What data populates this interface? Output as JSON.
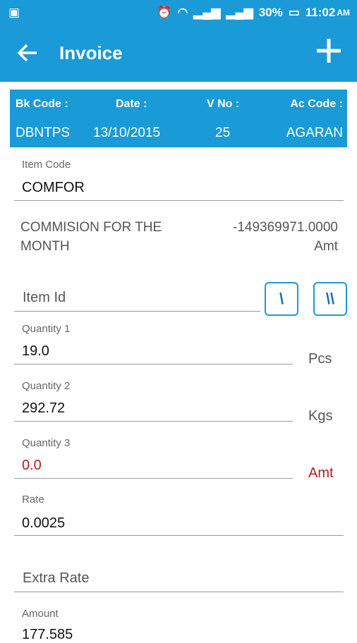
{
  "status": {
    "battery": "30%",
    "time": "11:02",
    "ampm": "AM"
  },
  "appbar": {
    "title": "Invoice",
    "back_icon": "arrow-back-icon",
    "add_icon": "plus-icon"
  },
  "header": {
    "bk_code_label": "Bk Code :",
    "date_label": "Date :",
    "vno_label": "V No :",
    "ac_code_label": "Ac Code :",
    "bk_code": "DBNTPS",
    "date": "13/10/2015",
    "vno": "25",
    "ac_code": "AGARAN"
  },
  "item_code": {
    "label": "Item Code",
    "value": "COMFOR"
  },
  "description": {
    "line1": "COMMISION FOR THE",
    "line2": "MONTH",
    "amount": "-149369971.0000",
    "amount_unit": "Amt"
  },
  "item_id": {
    "placeholder": "Item Id",
    "btn1": "\\",
    "btn2": "\\\\"
  },
  "quantity1": {
    "label": "Quantity 1",
    "value": "19.0",
    "unit": "Pcs"
  },
  "quantity2": {
    "label": "Quantity 2",
    "value": "292.72",
    "unit": "Kgs"
  },
  "quantity3": {
    "label": "Quantity 3",
    "value": "0.0",
    "unit": "Amt"
  },
  "rate": {
    "label": "Rate",
    "value": "0.0025"
  },
  "extra_rate": {
    "placeholder": "Extra Rate"
  },
  "amount": {
    "label": "Amount",
    "value": "177.585"
  },
  "colors": {
    "primary": "#1a9ad6",
    "error": "#b71c1c"
  }
}
